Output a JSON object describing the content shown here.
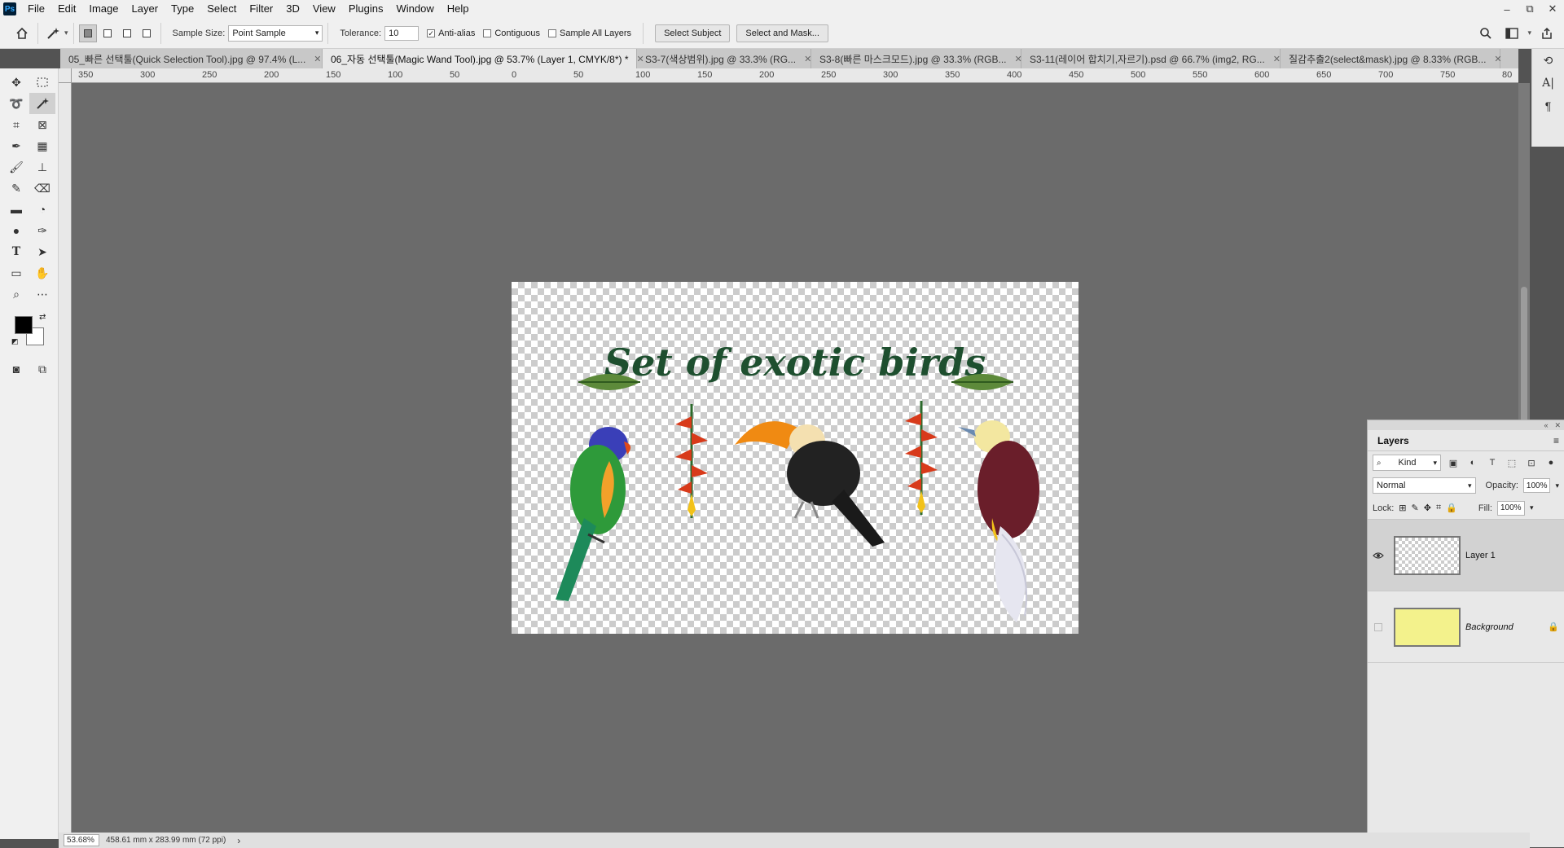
{
  "menu": {
    "logo": "Ps",
    "items": [
      "File",
      "Edit",
      "Image",
      "Layer",
      "Type",
      "Select",
      "Filter",
      "3D",
      "View",
      "Plugins",
      "Window",
      "Help"
    ]
  },
  "window_controls": {
    "minimize": "–",
    "restore": "⧉",
    "close": "✕"
  },
  "options": {
    "sample_size_label": "Sample Size:",
    "sample_size_value": "Point Sample",
    "tolerance_label": "Tolerance:",
    "tolerance_value": "10",
    "anti_alias_label": "Anti-alias",
    "anti_alias_checked": true,
    "contiguous_label": "Contiguous",
    "contiguous_checked": false,
    "sample_all_label": "Sample All Layers",
    "sample_all_checked": false,
    "select_subject": "Select Subject",
    "select_and_mask": "Select and Mask..."
  },
  "tabs": [
    {
      "label": "05_빠른 선택툴(Quick Selection Tool).jpg @ 97.4% (L...",
      "active": false
    },
    {
      "label": "06_자동 선택툴(Magic Wand Tool).jpg @ 53.7% (Layer 1, CMYK/8*) *",
      "active": true
    },
    {
      "label": "S3-7(색상범위).jpg @ 33.3% (RG...",
      "active": false
    },
    {
      "label": "S3-8(빠른 마스크모드).jpg @ 33.3% (RGB...",
      "active": false
    },
    {
      "label": "S3-11(레이어 합치기,자르기).psd @ 66.7% (img2, RG...",
      "active": false
    },
    {
      "label": "질감추출2(select&mask).jpg @ 8.33% (RGB...",
      "active": false
    }
  ],
  "ruler_top_labels": [
    "350",
    "300",
    "250",
    "200",
    "150",
    "100",
    "50",
    "0",
    "50",
    "100",
    "150",
    "200",
    "250",
    "300",
    "350",
    "400",
    "450",
    "500",
    "550",
    "600",
    "650",
    "700",
    "750",
    "80"
  ],
  "canvas": {
    "title_text": "Set of exotic birds"
  },
  "status": {
    "zoom": "53.68%",
    "doc_size": "458.61 mm x 283.99 mm (72 ppi)",
    "arrow": "›"
  },
  "layers": {
    "tab_label": "Layers",
    "kind_label": "Kind",
    "blend_mode": "Normal",
    "opacity_label": "Opacity:",
    "opacity_value": "100%",
    "lock_label": "Lock:",
    "fill_label": "Fill:",
    "fill_value": "100%",
    "items": [
      {
        "name": "Layer 1",
        "visible": true,
        "selected": true
      },
      {
        "name": "Background",
        "visible": false,
        "selected": false,
        "locked": true
      }
    ]
  },
  "colors": {
    "workspace": "#6b6b6b",
    "canvas_title": "#1e4f2f",
    "foreground": "#000000",
    "background": "#ffffff"
  }
}
